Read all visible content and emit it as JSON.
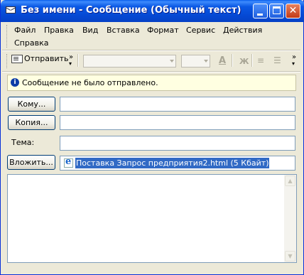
{
  "window": {
    "title": "Без имени - Сообщение (Обычный текст)"
  },
  "menu": {
    "items": [
      "Файл",
      "Правка",
      "Вид",
      "Вставка",
      "Формат",
      "Сервис",
      "Действия",
      "Справка"
    ]
  },
  "toolbar": {
    "send_label": "Отправить",
    "overflow": "»"
  },
  "infobar": {
    "text": "Сообщение не было отправлено."
  },
  "header": {
    "to_button": "Кому...",
    "cc_button": "Копия...",
    "subject_label": "Тема:",
    "attach_button": "Вложить...",
    "to_value": "",
    "cc_value": "",
    "subject_value": ""
  },
  "attachment": {
    "name": "Поставка Запрос предприятия2.html (5 Кбайт)"
  },
  "icons": {
    "info": "i",
    "scroll_up": "▲",
    "scroll_down": "▼",
    "close": "✕"
  }
}
